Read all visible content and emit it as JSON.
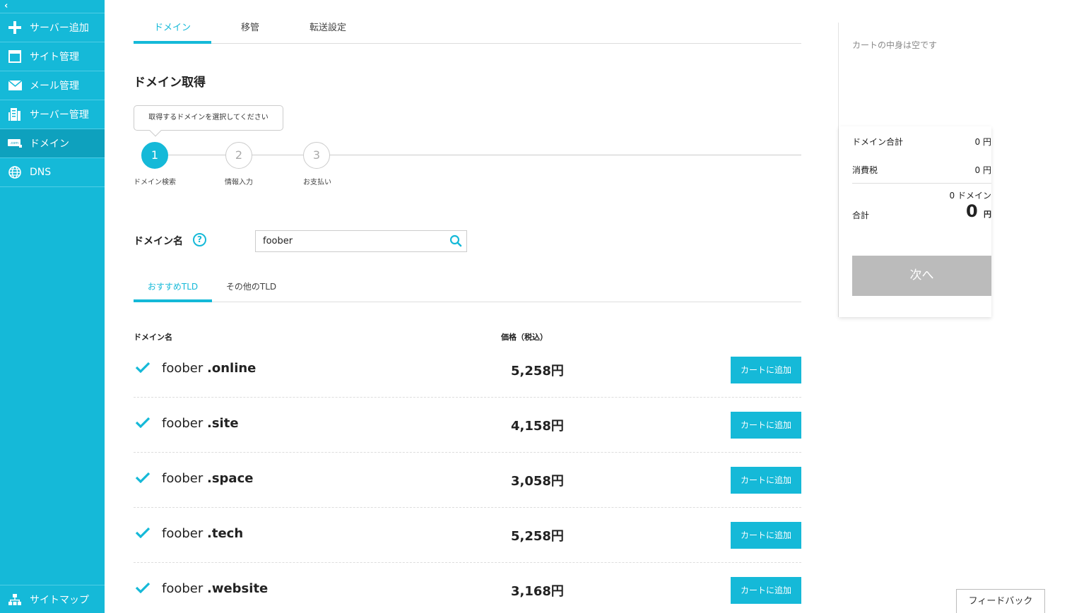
{
  "sidebar": {
    "items": [
      {
        "label": "サーバー追加",
        "icon": "plus-icon"
      },
      {
        "label": "サイト管理",
        "icon": "window-icon"
      },
      {
        "label": "メール管理",
        "icon": "mail-icon"
      },
      {
        "label": "サーバー管理",
        "icon": "server-icon"
      },
      {
        "label": "ドメイン",
        "icon": "domain-icon",
        "active": true
      },
      {
        "label": "DNS",
        "icon": "globe-icon"
      }
    ],
    "sitemap_label": "サイトマップ"
  },
  "tabs": [
    "ドメイン",
    "移管",
    "転送設定"
  ],
  "page_title": "ドメイン取得",
  "tooltip": "取得するドメインを選択してください",
  "steps": [
    {
      "num": "1",
      "label": "ドメイン検索"
    },
    {
      "num": "2",
      "label": "情報入力"
    },
    {
      "num": "3",
      "label": "お支払い"
    }
  ],
  "search": {
    "label": "ドメイン名",
    "help": "?",
    "value": "foober"
  },
  "subtabs": [
    "おすすめTLD",
    "その他のTLD"
  ],
  "table": {
    "col_domain": "ドメイン名",
    "col_price": "価格（税込）",
    "add_label": "カートに追加",
    "rows": [
      {
        "name": "foober",
        "tld": ".online",
        "price": "5,258円"
      },
      {
        "name": "foober",
        "tld": ".site",
        "price": "4,158円"
      },
      {
        "name": "foober",
        "tld": ".space",
        "price": "3,058円"
      },
      {
        "name": "foober",
        "tld": ".tech",
        "price": "5,258円"
      },
      {
        "name": "foober",
        "tld": ".website",
        "price": "3,168円"
      }
    ]
  },
  "cart": {
    "empty": "カートの中身は空です",
    "domain_total_label": "ドメイン合計",
    "domain_total_value": "0 円",
    "tax_label": "消費税",
    "tax_value": "0 円",
    "count": "0 ドメイン",
    "total_label": "合計",
    "total_value": "0",
    "total_unit": "円",
    "next": "次へ"
  },
  "feedback": "フィードバック",
  "colors": {
    "accent": "#15b9d8",
    "disabled": "#bbbbbb"
  }
}
